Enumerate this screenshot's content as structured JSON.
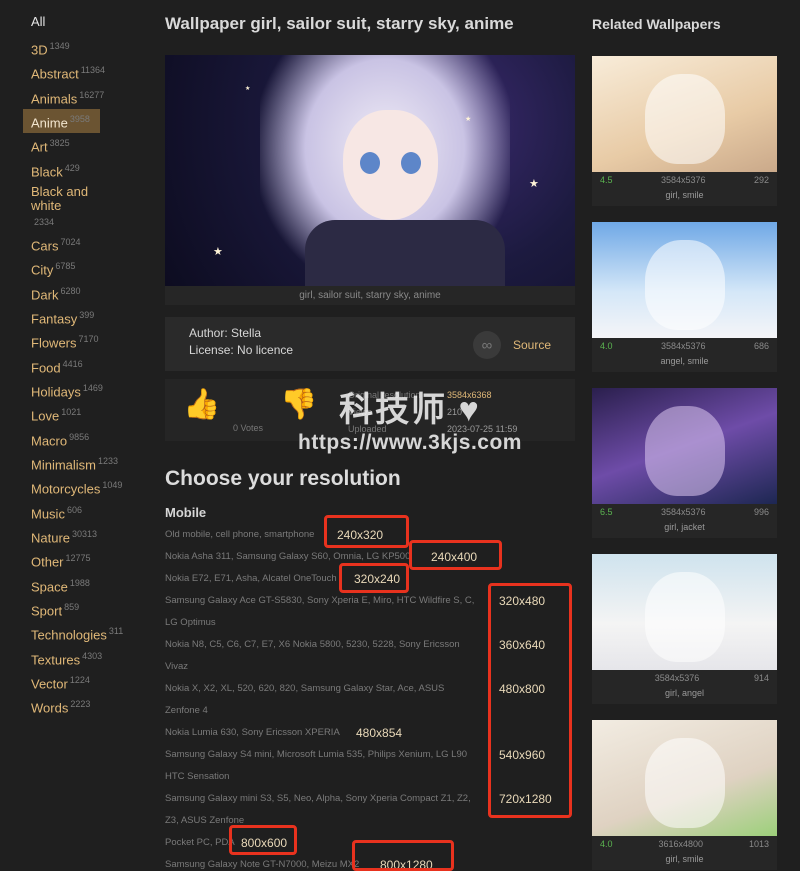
{
  "categories": [
    {
      "label": "All",
      "count": ""
    },
    {
      "label": "3D",
      "count": "1349"
    },
    {
      "label": "Abstract",
      "count": "11364"
    },
    {
      "label": "Animals",
      "count": "16277"
    },
    {
      "label": "Anime",
      "count": "3958"
    },
    {
      "label": "Art",
      "count": "3825"
    },
    {
      "label": "Black",
      "count": "429"
    },
    {
      "label": "Black and white",
      "count": "2334"
    },
    {
      "label": "Cars",
      "count": "7024"
    },
    {
      "label": "City",
      "count": "6785"
    },
    {
      "label": "Dark",
      "count": "6280"
    },
    {
      "label": "Fantasy",
      "count": "399"
    },
    {
      "label": "Flowers",
      "count": "7170"
    },
    {
      "label": "Food",
      "count": "4416"
    },
    {
      "label": "Holidays",
      "count": "1469"
    },
    {
      "label": "Love",
      "count": "1021"
    },
    {
      "label": "Macro",
      "count": "9856"
    },
    {
      "label": "Minimalism",
      "count": "1233"
    },
    {
      "label": "Motorcycles",
      "count": "1049"
    },
    {
      "label": "Music",
      "count": "606"
    },
    {
      "label": "Nature",
      "count": "30313"
    },
    {
      "label": "Other",
      "count": "12775"
    },
    {
      "label": "Space",
      "count": "1988"
    },
    {
      "label": "Sport",
      "count": "859"
    },
    {
      "label": "Technologies",
      "count": "311"
    },
    {
      "label": "Textures",
      "count": "4303"
    },
    {
      "label": "Vector",
      "count": "1224"
    },
    {
      "label": "Words",
      "count": "2223"
    }
  ],
  "main": {
    "title": "Wallpaper girl, sailor suit, starry sky, anime",
    "caption": "girl, sailor suit, starry sky, anime",
    "author": "Author: Stella",
    "license": "License: No licence",
    "source_label": "Source",
    "votes": "0 Votes",
    "meta": {
      "original_label": "Original resolution",
      "original_value": "3584x6368",
      "views_label": "Views",
      "views_value": "210",
      "uploaded_label": "Uploaded",
      "uploaded_value": "2023-07-25 11:59"
    },
    "choose_title": "Choose your resolution",
    "mobile_title": "Mobile",
    "resolutions": [
      {
        "devices": "Old mobile, cell phone, smartphone",
        "res": "240x320"
      },
      {
        "devices": "Nokia Asha 311, Samsung Galaxy S60, Omnia, LG KP500",
        "res": "240x400"
      },
      {
        "devices": "Nokia E72, E71, Asha, Alcatel OneTouch",
        "res": "320x240"
      },
      {
        "devices": "Samsung Galaxy Ace GT-S5830, Sony Xperia E, Miro, HTC Wildfire S, C,",
        "res": "320x480"
      },
      {
        "devices": "LG Optimus",
        "res": ""
      },
      {
        "devices": "Nokia N8, C5, C6, C7, E7, X6 Nokia 5800, 5230, 5228, Sony Ericsson",
        "res": "360x640"
      },
      {
        "devices": "Vivaz",
        "res": ""
      },
      {
        "devices": "Nokia X, X2, XL, 520, 620, 820, Samsung Galaxy Star, Ace, ASUS",
        "res": "480x800"
      },
      {
        "devices": "Zenfone 4",
        "res": ""
      },
      {
        "devices": "Nokia Lumia 630, Sony Ericsson XPERIA",
        "res": "480x854"
      },
      {
        "devices": "Samsung Galaxy S4 mini, Microsoft Lumia 535, Philips Xenium, LG L90",
        "res": "540x960"
      },
      {
        "devices": "HTC Sensation",
        "res": ""
      },
      {
        "devices": "Samsung Galaxy mini S3, S5, Neo, Alpha, Sony Xperia Compact Z1, Z2,",
        "res": "720x1280"
      },
      {
        "devices": "Z3, ASUS Zenfone",
        "res": ""
      },
      {
        "devices": "Pocket PC, PDA",
        "res": "800x600"
      },
      {
        "devices": "Samsung Galaxy Note GT-N7000, Meizu MX2",
        "res": "800x1280"
      }
    ]
  },
  "watermark": {
    "top": "科技师",
    "url": "https://www.3kjs.com"
  },
  "related": {
    "title": "Related Wallpapers",
    "cards": [
      {
        "rating": "4.5",
        "size": "3584x5376",
        "downloads": "292",
        "tags": "girl, smile"
      },
      {
        "rating": "4.0",
        "size": "3584x5376",
        "downloads": "686",
        "tags": "angel, smile"
      },
      {
        "rating": "6.5",
        "size": "3584x5376",
        "downloads": "996",
        "tags": "girl, jacket"
      },
      {
        "rating": "",
        "size": "3584x5376",
        "downloads": "914",
        "tags": "girl, angel"
      },
      {
        "rating": "4.0",
        "size": "3616x4800",
        "downloads": "1013",
        "tags": "girl, smile"
      }
    ]
  },
  "colors": {
    "background": "#1f1f1f",
    "accent": "#e0b878",
    "active_category": "#6b5432",
    "highlight_box": "#e8321e",
    "rating_green": "#5bb450"
  }
}
